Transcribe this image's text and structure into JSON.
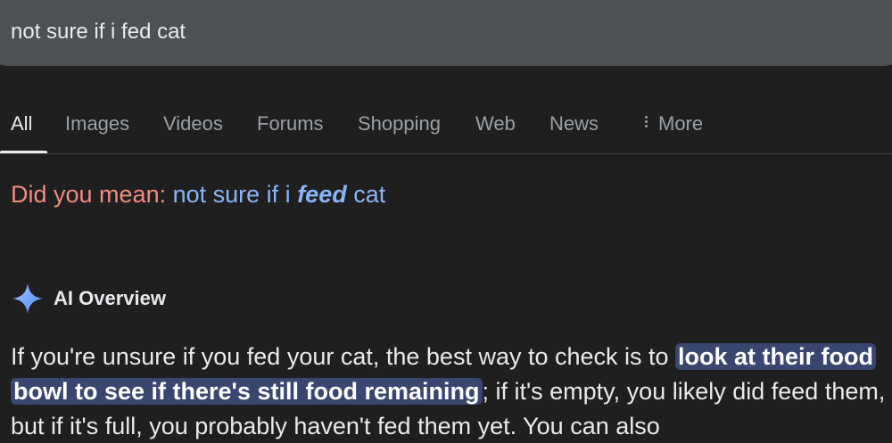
{
  "search": {
    "query": "not sure if i fed cat"
  },
  "tabs": [
    {
      "label": "All",
      "active": true
    },
    {
      "label": "Images"
    },
    {
      "label": "Videos"
    },
    {
      "label": "Forums"
    },
    {
      "label": "Shopping"
    },
    {
      "label": "Web"
    },
    {
      "label": "News"
    },
    {
      "label": "More",
      "icon": "more-vert-icon"
    }
  ],
  "did_you_mean": {
    "label": "Did you mean:",
    "prefix": "not sure if i",
    "emphasis": "feed",
    "suffix": "cat"
  },
  "ai_overview": {
    "icon": "sparkle-icon",
    "title": "AI Overview",
    "text_before": "If you're unsure if you fed your cat, the best way to check is to ",
    "highlight": "look at their food bowl to see if there's still food remaining",
    "text_after": "; if it's empty, you likely did feed them, but if it's full, you probably haven't fed them yet. You can also"
  },
  "colors": {
    "background": "#1f1f1f",
    "search_bar": "#4d5156",
    "link_blue": "#8ab4f8",
    "suggestion_red": "#f28b82",
    "highlight_bg": "#394770"
  }
}
